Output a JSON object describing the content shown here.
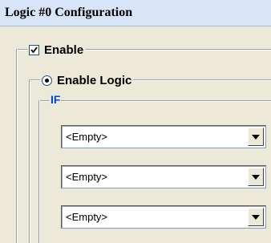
{
  "window": {
    "title": "Logic #0 Configuration"
  },
  "enable": {
    "label": "Enable",
    "checked": true
  },
  "enable_logic": {
    "label": "Enable Logic",
    "selected": true
  },
  "if_group": {
    "label": "IF",
    "conditions": [
      {
        "value": "<Empty>"
      },
      {
        "value": "<Empty>"
      },
      {
        "value": "<Empty>"
      }
    ]
  }
}
